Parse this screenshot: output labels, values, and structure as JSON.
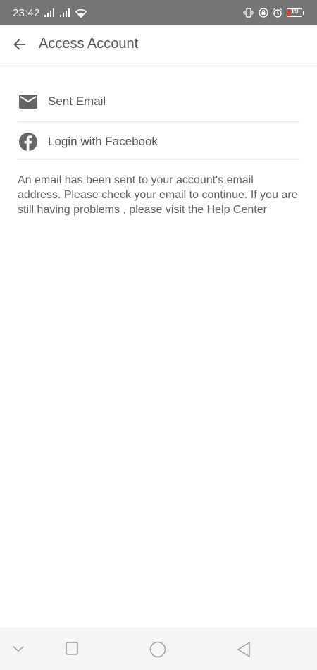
{
  "status_bar": {
    "time": "23:42",
    "battery_level": "19",
    "icons": [
      "signal-icon",
      "signal-icon",
      "wifi-icon",
      "vibrate-icon",
      "lock-rotation-icon",
      "alarm-icon",
      "battery-icon"
    ]
  },
  "app_bar": {
    "title": "Access Account"
  },
  "options": [
    {
      "label": "Sent Email",
      "icon": "email-icon"
    },
    {
      "label": "Login with Facebook",
      "icon": "facebook-icon"
    }
  ],
  "message": "An email has been sent to your account's email address. Please check your email to continue. If you are still having problems , please visit the Help Center",
  "nav_bar": {
    "icons": [
      "nav-down-icon",
      "recents-icon",
      "home-icon",
      "back-triangle-icon"
    ]
  },
  "colors": {
    "status_bar": "#757575",
    "text": "#555555",
    "battery_low": "#e53935"
  }
}
